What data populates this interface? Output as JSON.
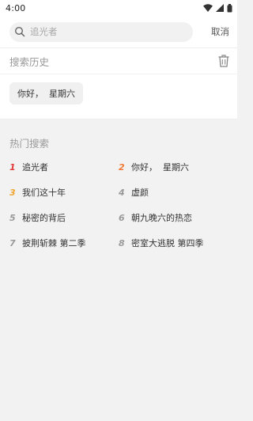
{
  "status_bar": {
    "time": "4:00"
  },
  "search": {
    "placeholder": "追光者",
    "cancel_label": "取消"
  },
  "history": {
    "title": "搜索历史",
    "items": [
      {
        "label": "你好，  星期六"
      }
    ]
  },
  "hot": {
    "title": "热门搜索",
    "items": [
      {
        "rank": "1",
        "label": "追光者"
      },
      {
        "rank": "2",
        "label": "你好，  星期六"
      },
      {
        "rank": "3",
        "label": "我们这十年"
      },
      {
        "rank": "4",
        "label": "虚颜"
      },
      {
        "rank": "5",
        "label": "秘密的背后"
      },
      {
        "rank": "6",
        "label": "朝九晚六的热恋"
      },
      {
        "rank": "7",
        "label": "披荆斩棘 第二季"
      },
      {
        "rank": "8",
        "label": "密室大逃脱 第四季"
      }
    ]
  },
  "colors": {
    "rank_1": "#e23a3a",
    "rank_2": "#f07a3a",
    "rank_3": "#f0a630",
    "rank_other": "#999999"
  },
  "icons": {
    "search": "search-icon",
    "trash": "trash-icon",
    "wifi": "wifi-icon",
    "signal": "signal-icon",
    "battery": "battery-icon"
  }
}
